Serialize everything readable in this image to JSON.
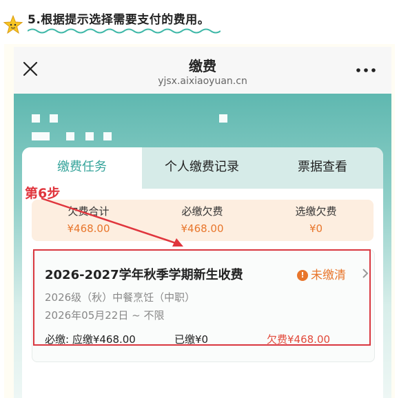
{
  "tutorial": {
    "title": "5.根据提示选择需要支付的费用。"
  },
  "browser": {
    "title": "缴费",
    "url": "yjsx.aixiaoyuan.cn"
  },
  "tabs": [
    "缴费任务",
    "个人缴费记录",
    "票据查看"
  ],
  "summary": [
    {
      "label": "欠费合计",
      "value": "¥468.00"
    },
    {
      "label": "必缴欠费",
      "value": "¥468.00"
    },
    {
      "label": "选缴欠费",
      "value": "¥0"
    }
  ],
  "fee_item": {
    "title": "2026-2027学年秋季学期新生收费",
    "status": "未缴清",
    "status_icon": "!",
    "class_info": "2026级（秋）中餐烹饪（中职）",
    "date_info": "2026年05月22日 ~ 不限",
    "required_text": "必缴: 应缴¥468.00",
    "paid_text": "已缴¥0",
    "owed_text": "欠费¥468.00"
  },
  "annotation": {
    "step_label": "第6步"
  },
  "colors": {
    "accent": "#34a39a",
    "warning": "#e8762c",
    "annotation_red": "#d9363e"
  }
}
